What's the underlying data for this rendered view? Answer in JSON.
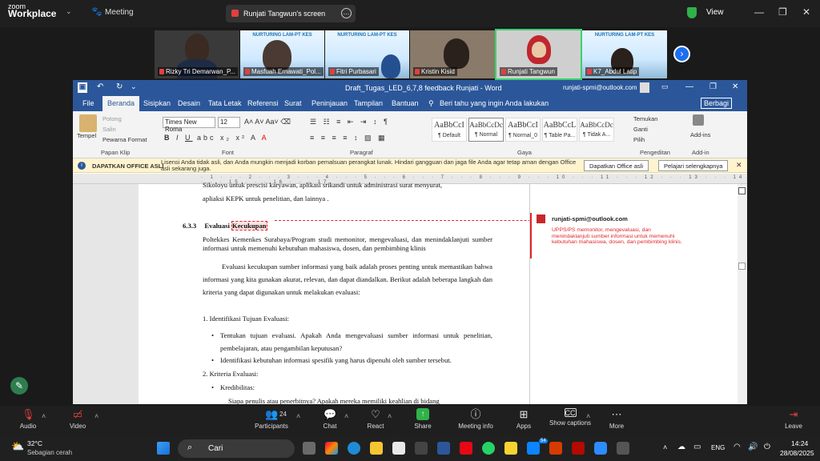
{
  "zoom": {
    "brand_top": "zoom",
    "brand_bottom": "Workplace",
    "meeting_label": "Meeting",
    "screen_share_label": "Runjati Tangwun's screen",
    "view_label": "View",
    "participants": [
      {
        "name": "Rizky Tri Demarwan_P..."
      },
      {
        "name": "Masfuah Ernawati_Pol..."
      },
      {
        "name": "Fitri Purbasari"
      },
      {
        "name": "Kristin Kisid"
      },
      {
        "name": "Runjati Tangwun"
      },
      {
        "name": "K7_Abdul Latip"
      }
    ],
    "banner_text": "NURTURING LAM-PT KES",
    "toolbar": {
      "audio": "Audio",
      "video": "Video",
      "participants": "Participants",
      "participants_count": "24",
      "chat": "Chat",
      "react": "React",
      "share": "Share",
      "meeting_info": "Meeting info",
      "apps": "Apps",
      "show_captions": "Show captions",
      "more": "More",
      "leave": "Leave"
    },
    "share_color": "#2fb24a"
  },
  "word": {
    "doc_title": "Draft_Tugas_LED_6,7,8 feedback Runjati  -  Word",
    "account": "runjati-spmi@outlook.com",
    "tabs": [
      "File",
      "Beranda",
      "Sisipkan",
      "Desain",
      "Tata Letak",
      "Referensi",
      "Surat",
      "Peninjauan",
      "Tampilan",
      "Bantuan"
    ],
    "tell_me": "Beri tahu yang ingin Anda lakukan",
    "share_button": "Berbagi",
    "clipboard": {
      "paste": "Tempel",
      "cut": "Potong",
      "copy": "Salin",
      "format_painter": "Pewarna Format",
      "label": "Papan Klip"
    },
    "font": {
      "name": "Times New Roma",
      "size": "12",
      "label": "Font"
    },
    "paragraph_label": "Paragraf",
    "styles": [
      {
        "preview": "AaBbCcI",
        "name": "¶ Default"
      },
      {
        "preview": "AaBbCcDc",
        "name": "¶ Normal"
      },
      {
        "preview": "AaBbCcI",
        "name": "¶ Normal_0"
      },
      {
        "preview": "AaBbCcL",
        "name": "¶ Table Pa..."
      },
      {
        "preview": "AaBbCcDc",
        "name": "¶ Tidak A..."
      }
    ],
    "styles_label": "Gaya",
    "editing": {
      "find": "Temukan",
      "replace": "Ganti",
      "select": "Pilih",
      "label": "Pengeditan"
    },
    "addins": {
      "button": "Add-ins",
      "label": "Add-in"
    },
    "infobar": {
      "title": "DAPATKAN OFFICE ASLI",
      "message": "Lisensi Anda tidak asli, dan Anda mungkin menjadi korban pemalsuan perangkat lunak. Hindari gangguan dan jaga file Anda agar tetap aman dengan Office asli sekarang juga.",
      "btn_get": "Dapatkan Office asli",
      "btn_learn": "Pelajari selengkapnya"
    },
    "document": {
      "line_top1": "Sikoloyu untuk prescisi karyawan, aplikasi srikandi untuk administrasi surat menyurat,",
      "line_top2": "apliaksi KEPK untuk penelitian, dan lainnya .",
      "heading_num": "6.3.3",
      "heading_pre": "Evaluasi ",
      "heading_highlight": "Kecukupan",
      "p1": "Poltekkes Kemenkes Surabaya/Program studi memonitor, mengevaluasi, dan menindaklanjuti sumber informasi untuk memenuhi kebutuhan mahasiswa, dosen, dan pembimbing klinis",
      "p2": "Evaluasi kecukupan sumber informasi yang baik adalah proses penting untuk memastikan bahwa informasi yang kita gunakan akurat, relevan, dan dapat diandalkan. Berikut adalah beberapa langkah dan kriteria yang dapat digunakan untuk melakukan evaluasi:",
      "item1": "1.  Identifikasi Tujuan Evaluasi:",
      "b1": "Tentukan tujuan evaluasi. Apakah Anda mengevaluasi sumber informasi untuk penelitian, pembelajaran, atau pengambilan keputusan?",
      "b2": "Identifikasi kebutuhan informasi spesifik yang harus dipenuhi oleh sumber tersebut.",
      "item2": "2.  Kriteria Evaluasi:",
      "b3": "Kredibilitas:",
      "sub1": "Siapa penulis atau penerbitnya? Apakah mereka memiliki keahlian di bidang"
    },
    "comment": {
      "author": "runjati-spmi@outlook.com",
      "text": "UPPS/PS memonitor, mengevaluasi, dan menindaklanjuti sumber informasi untuk memenuhi kebutuhan mahasiswa, dosen, dan pembimbing klinis."
    },
    "accent_color": "#2b579a",
    "comment_color": "#e0262b"
  },
  "taskbar": {
    "temperature": "32°C",
    "weather": "Sebagian cerah",
    "search": "Cari",
    "language": "ENG",
    "time": "14:24",
    "date": "28/08/2025",
    "chat_badge": "54"
  }
}
